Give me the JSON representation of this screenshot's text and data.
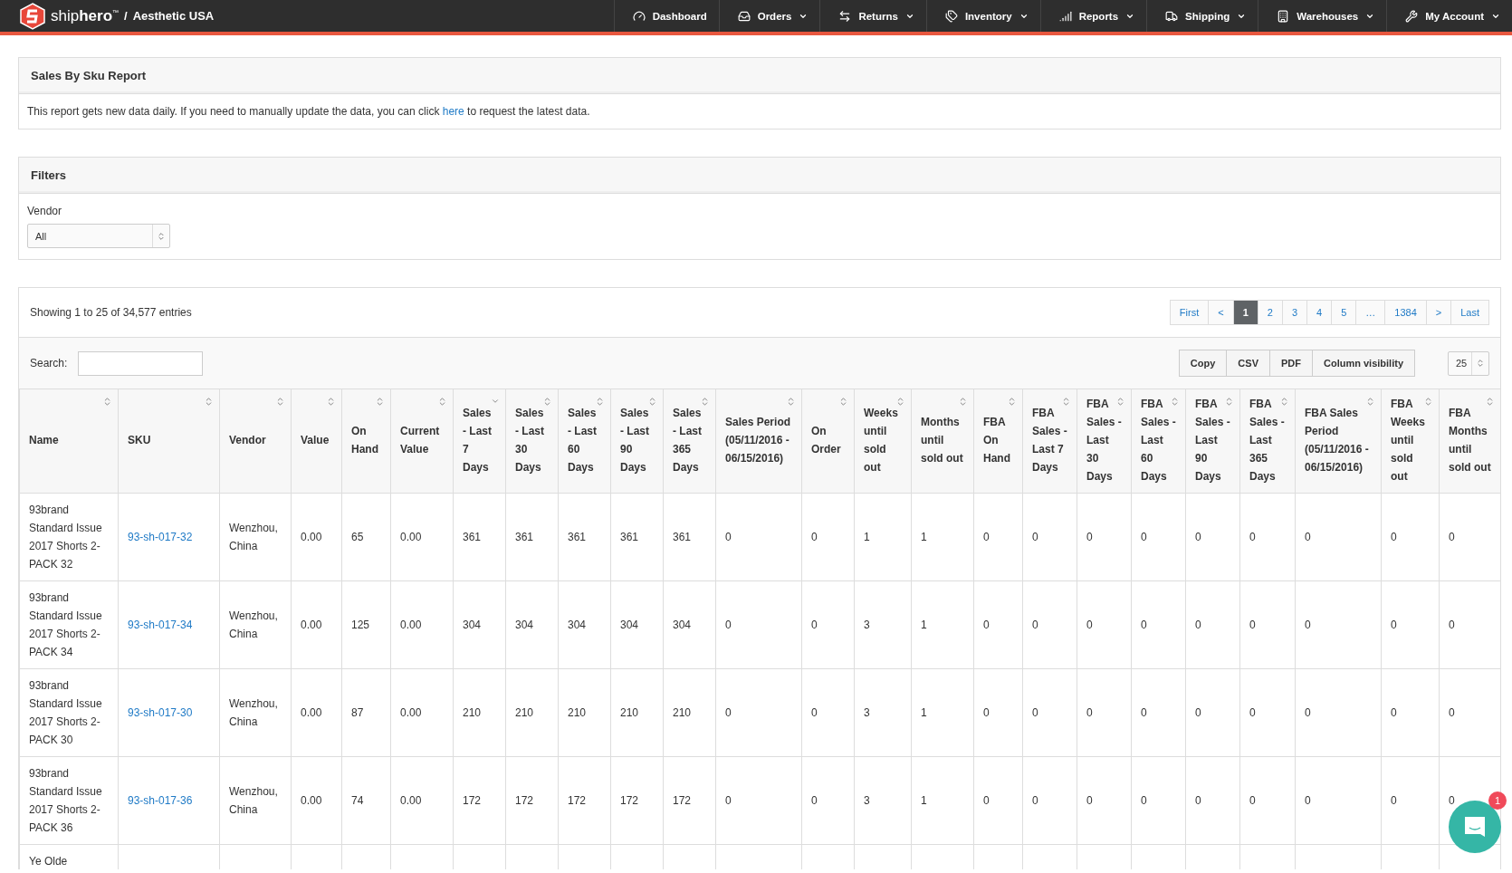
{
  "brand": {
    "name": "ship**hero**$^{™}$",
    "separator": "/",
    "account": "Aesthetic USA"
  },
  "nav": [
    {
      "label": "Dashboard",
      "dropdown": false
    },
    {
      "label": "Orders",
      "dropdown": true
    },
    {
      "label": "Returns",
      "dropdown": true
    },
    {
      "label": "Inventory",
      "dropdown": true
    },
    {
      "label": "Reports",
      "dropdown": true
    },
    {
      "label": "Shipping",
      "dropdown": true
    },
    {
      "label": "Warehouses",
      "dropdown": true
    },
    {
      "label": "My Account",
      "dropdown": true
    }
  ],
  "report_panel": {
    "title": "Sales By Sku Report",
    "text_before": "This report gets new data daily. If you need to manually update the data, you can click ",
    "link": "here",
    "text_after": " to request the latest data."
  },
  "filters": {
    "title": "Filters",
    "vendor_label": "Vendor",
    "vendor_value": "All"
  },
  "table_info": "Showing 1 to 25 of 34,577 entries",
  "pagination": [
    {
      "label": "First",
      "selected": false
    },
    {
      "label": "<",
      "selected": false
    },
    {
      "label": "1",
      "selected": true
    },
    {
      "label": "2",
      "selected": false
    },
    {
      "label": "3",
      "selected": false
    },
    {
      "label": "4",
      "selected": false
    },
    {
      "label": "5",
      "selected": false
    },
    {
      "label": "…",
      "selected": false
    },
    {
      "label": "1384",
      "selected": false
    },
    {
      "label": ">",
      "selected": false
    },
    {
      "label": "Last",
      "selected": false
    }
  ],
  "search_label": "Search:",
  "export_buttons": [
    "Copy",
    "CSV",
    "PDF",
    "Column visibility"
  ],
  "page_size": "25",
  "columns": [
    {
      "label": "Name",
      "sorted": false
    },
    {
      "label": "SKU",
      "sorted": false
    },
    {
      "label": "Vendor",
      "sorted": false
    },
    {
      "label": "Value",
      "sorted": false
    },
    {
      "label": "On Hand",
      "sorted": false
    },
    {
      "label": "Current Value",
      "sorted": false
    },
    {
      "label": "Sales - Last 7 Days",
      "sorted": true
    },
    {
      "label": "Sales - Last 30 Days",
      "sorted": false
    },
    {
      "label": "Sales - Last 60 Days",
      "sorted": false
    },
    {
      "label": "Sales - Last 90 Days",
      "sorted": false
    },
    {
      "label": "Sales - Last 365 Days",
      "sorted": false
    },
    {
      "label": "Sales Period (05/11/2016 - 06/15/2016)",
      "sorted": false
    },
    {
      "label": "On Order",
      "sorted": false
    },
    {
      "label": "Weeks until sold out",
      "sorted": false
    },
    {
      "label": "Months until sold out",
      "sorted": false
    },
    {
      "label": "FBA On Hand",
      "sorted": false
    },
    {
      "label": "FBA Sales - Last 7 Days",
      "sorted": false
    },
    {
      "label": "FBA Sales - Last 30 Days",
      "sorted": false
    },
    {
      "label": "FBA Sales - Last 60 Days",
      "sorted": false
    },
    {
      "label": "FBA Sales - Last 90 Days",
      "sorted": false
    },
    {
      "label": "FBA Sales - Last 365 Days",
      "sorted": false
    },
    {
      "label": "FBA Sales Period (05/11/2016 - 06/15/2016)",
      "sorted": false
    },
    {
      "label": "FBA Weeks until sold out",
      "sorted": false
    },
    {
      "label": "FBA Months until sold out",
      "sorted": false
    }
  ],
  "rows": [
    {
      "cells": [
        "93brand Standard Issue 2017 Shorts 2-PACK 32",
        "93-sh-017-32",
        "Wenzhou, China",
        "0.00",
        "65",
        "0.00",
        "361",
        "361",
        "361",
        "361",
        "361",
        "0",
        "0",
        "1",
        "1",
        "0",
        "0",
        "0",
        "0",
        "0",
        "0",
        "0",
        "0",
        "0"
      ]
    },
    {
      "cells": [
        "93brand Standard Issue 2017 Shorts 2-PACK 34",
        "93-sh-017-34",
        "Wenzhou, China",
        "0.00",
        "125",
        "0.00",
        "304",
        "304",
        "304",
        "304",
        "304",
        "0",
        "0",
        "3",
        "1",
        "0",
        "0",
        "0",
        "0",
        "0",
        "0",
        "0",
        "0",
        "0"
      ]
    },
    {
      "cells": [
        "93brand Standard Issue 2017 Shorts 2-PACK 30",
        "93-sh-017-30",
        "Wenzhou, China",
        "0.00",
        "87",
        "0.00",
        "210",
        "210",
        "210",
        "210",
        "210",
        "0",
        "0",
        "3",
        "1",
        "0",
        "0",
        "0",
        "0",
        "0",
        "0",
        "0",
        "0",
        "0"
      ]
    },
    {
      "cells": [
        "93brand Standard Issue 2017 Shorts 2-PACK 36",
        "93-sh-017-36",
        "Wenzhou, China",
        "0.00",
        "74",
        "0.00",
        "172",
        "172",
        "172",
        "172",
        "172",
        "0",
        "0",
        "3",
        "1",
        "0",
        "0",
        "0",
        "0",
        "0",
        "0",
        "0",
        "0",
        "0"
      ]
    },
    {
      "cells": [
        "Ye Olde"
      ]
    }
  ],
  "chat": {
    "badge": "1"
  }
}
